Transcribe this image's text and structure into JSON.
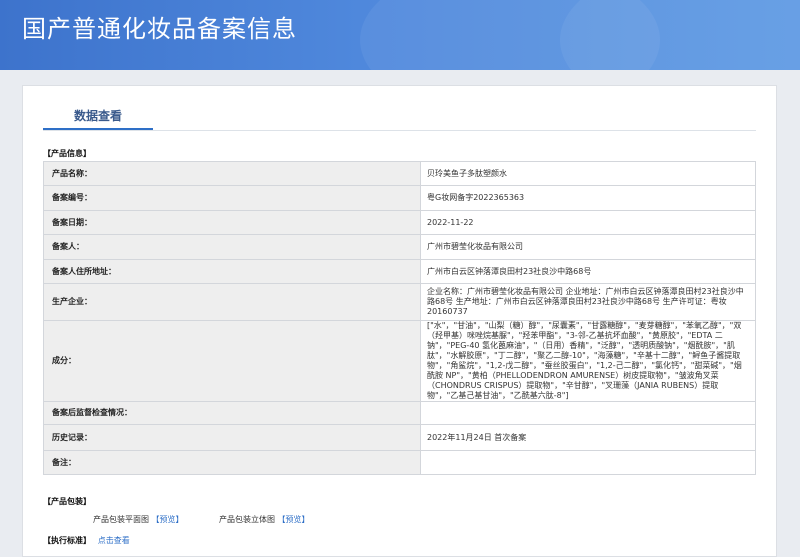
{
  "header": {
    "title": "国产普通化妆品备案信息"
  },
  "tab": {
    "label": "数据查看"
  },
  "product_info": {
    "section_title": "【产品信息】",
    "rows": [
      {
        "key": "产品名称：",
        "value": "贝玲美鱼子多肽塑颜水"
      },
      {
        "key": "备案编号：",
        "value": "粤G妆网备字2022365363"
      },
      {
        "key": "备案日期：",
        "value": "2022-11-22"
      },
      {
        "key": "备案人：",
        "value": "广州市碧莹化妆品有限公司"
      },
      {
        "key": "备案人住所地址：",
        "value": "广州市白云区钟落潭良田村23社良沙中路68号"
      },
      {
        "key": "生产企业：",
        "value": "企业名称：广州市碧莹化妆品有限公司 企业地址：广州市白云区钟落潭良田村23社良沙中路68号 生产地址：广州市白云区钟落潭良田村23社良沙中路68号 生产许可证：粤妆20160737"
      },
      {
        "key": "成分：",
        "value": "[\"水\"，\"甘油\"，\"山梨（糖）醇\"，\"尿囊素\"，\"甘露糖醇\"，\"麦芽糖醇\"，\"苯氧乙醇\"，\"双（羟甲基）咪唑烷基脲\"，\"羟苯甲酯\"，\"3-邻-乙基抗坏血酸\"，\"黄原胶\"，\"EDTA 二钠\"，\"PEG-40 氢化蓖麻油\"，\"（日用）香精\"，\"泛醇\"，\"透明质酸钠\"，\"烟酰胺\"，\"肌肽\"，\"水解胶原\"，\"丁二醇\"，\"聚乙二醇-10\"，\"海藻糖\"，\"辛基十二醇\"，\"鲟鱼子酱提取物\"，\"角鲨烷\"，\"1,2-戊二醇\"，\"蚕丝胶蛋白\"，\"1,2-己二醇\"，\"氯化钙\"，\"甜菜碱\"，\"烟酰胺 NP\"，\"黄柏（PHELLODENDRON AMURENSE）树皮提取物\"，\"皱波角叉菜（CHONDRUS CRISPUS）提取物\"，\"辛甘醇\"，\"叉珊藻（JANIA RUBENS）提取物\"，\"乙基己基甘油\"，\"乙酰基六肽-8\"]"
      },
      {
        "key": "备案后监督检查情况：",
        "value": ""
      },
      {
        "key": "历史记录：",
        "value": "2022年11月24日 首次备案"
      },
      {
        "key": "备注：",
        "value": ""
      }
    ]
  },
  "packaging": {
    "section_title": "【产品包装】",
    "items": [
      {
        "label": "产品包装平面图",
        "link": "【预览】"
      },
      {
        "label": "产品包装立体图",
        "link": "【预览】"
      }
    ]
  },
  "standard": {
    "section_title": "【执行标准】",
    "link": "点击查看"
  },
  "colors": {
    "header_start": "#3d73cc",
    "header_end": "#5f9ae4",
    "accent": "#2e6fc7"
  }
}
